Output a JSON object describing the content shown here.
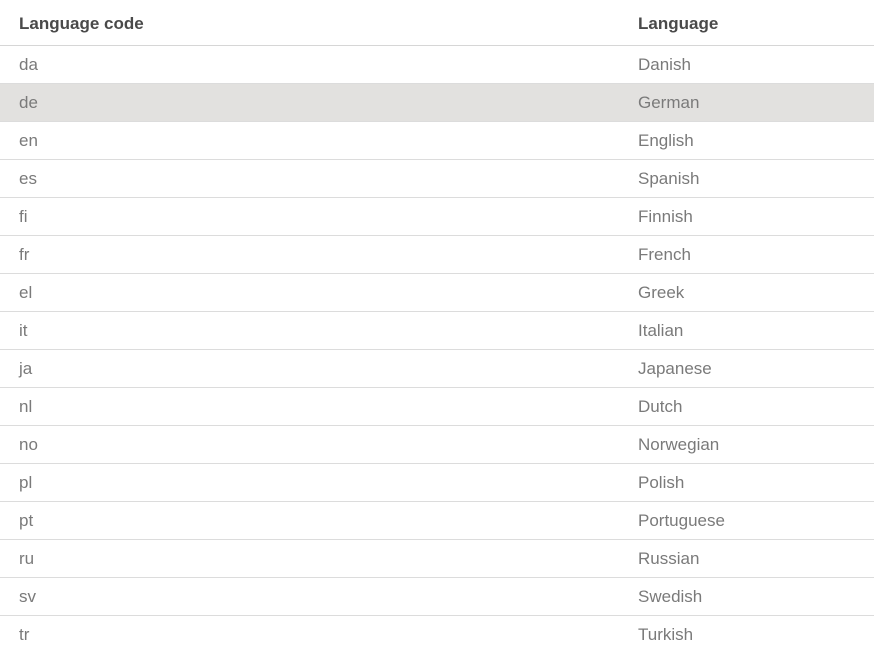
{
  "table": {
    "headers": {
      "code": "Language code",
      "language": "Language"
    },
    "rows": [
      {
        "code": "da",
        "language": "Danish"
      },
      {
        "code": "de",
        "language": "German"
      },
      {
        "code": "en",
        "language": "English"
      },
      {
        "code": "es",
        "language": "Spanish"
      },
      {
        "code": "fi",
        "language": "Finnish"
      },
      {
        "code": "fr",
        "language": "French"
      },
      {
        "code": "el",
        "language": "Greek"
      },
      {
        "code": "it",
        "language": "Italian"
      },
      {
        "code": "ja",
        "language": "Japanese"
      },
      {
        "code": "nl",
        "language": "Dutch"
      },
      {
        "code": "no",
        "language": "Norwegian"
      },
      {
        "code": "pl",
        "language": "Polish"
      },
      {
        "code": "pt",
        "language": "Portuguese"
      },
      {
        "code": "ru",
        "language": "Russian"
      },
      {
        "code": "sv",
        "language": "Swedish"
      },
      {
        "code": "tr",
        "language": "Turkish"
      }
    ],
    "highlighted_row": "de",
    "colors": {
      "highlight": "#e2e1df",
      "header_text": "#4a4a4a",
      "cell_text": "#7a7a7a",
      "divider": "#dcdcdc"
    }
  }
}
